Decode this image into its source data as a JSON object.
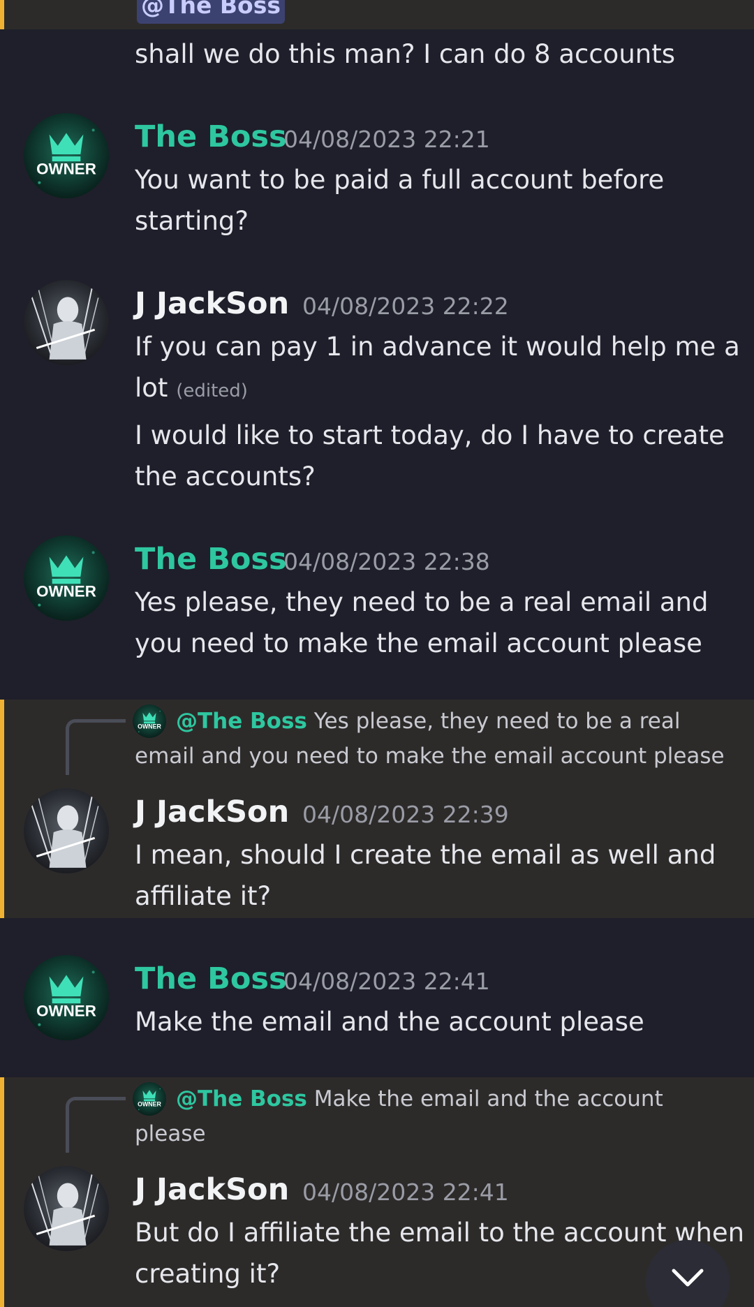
{
  "colors": {
    "background": "#1e1f2a",
    "highlight_band": "#2d2b2a",
    "highlight_border": "#f0b232",
    "boss_name": "#2ec7a0",
    "mention_chip": "#3c4270"
  },
  "top": {
    "mention_chip": "@The Boss",
    "message": "shall we do this man? I can do 8 accounts"
  },
  "messages": [
    {
      "author": "The Boss",
      "role_badge": "OWNER",
      "timestamp": "04/08/2023 22:21",
      "lines": [
        "You want to be paid a full account before",
        "starting?"
      ]
    },
    {
      "author": "J JackSon",
      "timestamp": "04/08/2023 22:22",
      "lines": [
        "If you can pay 1 in advance it would help me a",
        "lot"
      ],
      "edited_label": "(edited)",
      "followup_lines": [
        "I would like to start today, do I have to create",
        "the accounts?"
      ]
    },
    {
      "author": "The Boss",
      "role_badge": "OWNER",
      "timestamp": "04/08/2023 22:38",
      "lines": [
        "Yes please, they need to be a real email and",
        "you need to make the email account please"
      ]
    },
    {
      "author": "J JackSon",
      "timestamp": "04/08/2023 22:39",
      "reply": {
        "mention": "@The Boss",
        "lines": [
          " Yes please, they need to be a real",
          "email and you need to make the email account please"
        ]
      },
      "lines": [
        "I mean, should I create the email as well and",
        "affiliate it?"
      ]
    },
    {
      "author": "The Boss",
      "role_badge": "OWNER",
      "timestamp": "04/08/2023 22:41",
      "lines": [
        "Make the email and the account please"
      ]
    },
    {
      "author": "J JackSon",
      "timestamp": "04/08/2023 22:41",
      "reply": {
        "mention": "@The Boss",
        "lines": [
          " Make the email and the account",
          "please"
        ]
      },
      "lines": [
        "But do I affiliate the email to the account when",
        "creating it?"
      ]
    }
  ],
  "scroll_button": {
    "icon": "chevron-down-icon"
  }
}
